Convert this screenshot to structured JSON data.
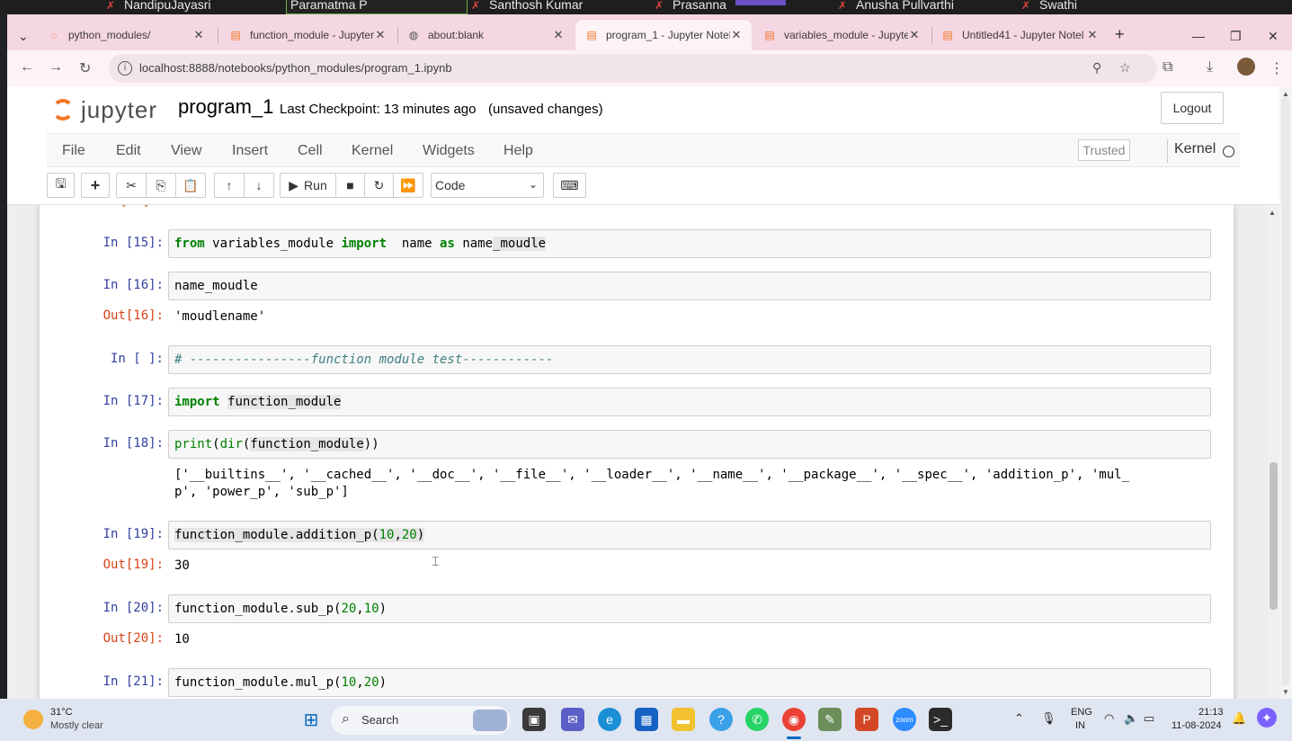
{
  "participants": [
    "NandipuJayasri",
    "Paramatma P",
    "Santhosh Kumar",
    "Prasanna",
    "Anusha Pullvarthi",
    "Swathi"
  ],
  "browser": {
    "tabs": [
      {
        "title": "python_modules/",
        "icon": "jupyter-spinner-icon",
        "active": false
      },
      {
        "title": "function_module - Jupyter",
        "icon": "jupyter-notebook-icon",
        "active": false
      },
      {
        "title": "about:blank",
        "icon": "globe-icon",
        "active": false
      },
      {
        "title": "program_1 - Jupyter Notel",
        "icon": "jupyter-notebook-icon",
        "active": true
      },
      {
        "title": "variables_module - Jupyter",
        "icon": "jupyter-notebook-icon",
        "active": false
      },
      {
        "title": "Untitled41 - Jupyter Notel",
        "icon": "jupyter-notebook-icon",
        "active": false
      }
    ],
    "url": "localhost:8888/notebooks/python_modules/program_1.ipynb"
  },
  "jupyter": {
    "logo_text": "jupyter",
    "notebook_name": "program_1",
    "checkpoint": "Last Checkpoint: 13 minutes ago",
    "unsaved": "(unsaved changes)",
    "logout": "Logout",
    "menu": [
      "File",
      "Edit",
      "View",
      "Insert",
      "Cell",
      "Kernel",
      "Widgets",
      "Help"
    ],
    "trusted": "Trusted",
    "kernel_name": "Kernel",
    "run_label": "Run",
    "cell_type": "Code"
  },
  "cells": {
    "c15": {
      "prompt": "In [15]:"
    },
    "c16": {
      "prompt": "In [16]:",
      "out_prompt": "Out[16]:",
      "output": "'moudlename'"
    },
    "cblank": {
      "prompt": "In [ ]:"
    },
    "c17": {
      "prompt": "In [17]:"
    },
    "c18": {
      "prompt": "In [18]:",
      "output": "['__builtins__', '__cached__', '__doc__', '__file__', '__loader__', '__name__', '__package__', '__spec__', 'addition_p', 'mul_\np', 'power_p', 'sub_p']"
    },
    "c19": {
      "prompt": "In [19]:",
      "out_prompt": "Out[19]:",
      "output": "30"
    },
    "c20": {
      "prompt": "In [20]:",
      "out_prompt": "Out[20]:",
      "output": "10"
    },
    "c21": {
      "prompt": "In [21]:"
    }
  },
  "code": {
    "c15_from": "from",
    "c15_mod": " variables_module ",
    "c15_import": "import",
    "c15_name": "  name ",
    "c15_as": "as",
    "c15_alias_a": " name",
    "c15_alias_b": "_moudle",
    "c16": "name_moudle",
    "cblank": "# ----------------function module test------------",
    "c17_import": "import",
    "c17_mod": "function_module",
    "c18_a": "print(dir(",
    "c18_b": "function_module",
    "c18_c": "))",
    "c19_a": "function_module.addition_p(",
    "c19_n1": "10",
    "c19_comma": ",",
    "c19_n2": "20",
    "c19_close": ")",
    "c20_a": "function_module.sub_p(",
    "c20_n1": "20",
    "c20_comma": ",",
    "c20_n2": "10",
    "c20_close": ")",
    "c21_a": "function_module.mul_p(",
    "c21_n1": "10",
    "c21_comma": ",",
    "c21_n2": "20",
    "c21_close": ")"
  },
  "taskbar": {
    "temp": "31°C",
    "weather": "Mostly clear",
    "search": "Search",
    "lang": "ENG",
    "region": "IN",
    "time": "21:13",
    "date": "11-08-2024"
  }
}
